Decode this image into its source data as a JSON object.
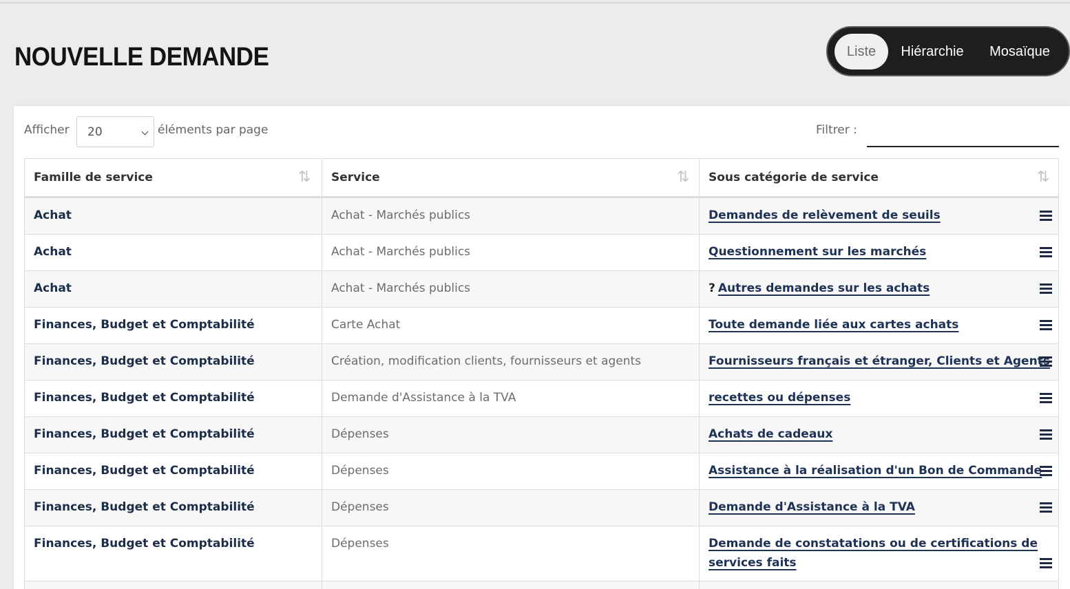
{
  "page": {
    "title": "NOUVELLE DEMANDE"
  },
  "view_switch": {
    "tabs": [
      "Liste",
      "Hiérarchie",
      "Mosaïque"
    ],
    "active": "Liste"
  },
  "controls": {
    "show_label": "Afficher",
    "page_size": "20",
    "per_page_label": "éléments par page",
    "filter_label": "Filtrer :",
    "filter_value": ""
  },
  "table": {
    "headers": [
      "Famille de service",
      "Service",
      "Sous catégorie de service"
    ],
    "sort_icon": "⇅",
    "rows": [
      {
        "famille": "Achat",
        "service": "Achat - Marchés publics",
        "sous": "Demandes de relèvement de seuils"
      },
      {
        "famille": "Achat",
        "service": "Achat - Marchés publics",
        "sous": "Questionnement sur les marchés"
      },
      {
        "famille": "Achat",
        "service": "Achat - Marchés publics",
        "sous": "Autres demandes sur les achats",
        "icon": "question-icon"
      },
      {
        "famille": "Finances, Budget et Comptabilité",
        "service": "Carte Achat",
        "sous": "Toute demande liée aux cartes achats"
      },
      {
        "famille": "Finances, Budget et Comptabilité",
        "service": "Création, modification clients, fournisseurs et agents",
        "sous": "Fournisseurs français et étranger, Clients et Agents"
      },
      {
        "famille": "Finances, Budget et Comptabilité",
        "service": "Demande d'Assistance à la TVA",
        "sous": "recettes ou dépenses"
      },
      {
        "famille": "Finances, Budget et Comptabilité",
        "service": "Dépenses",
        "sous": "Achats de cadeaux"
      },
      {
        "famille": "Finances, Budget et Comptabilité",
        "service": "Dépenses",
        "sous": "Assistance à la réalisation d'un Bon de Commande"
      },
      {
        "famille": "Finances, Budget et Comptabilité",
        "service": "Dépenses",
        "sous": "Demande d'Assistance à la TVA"
      },
      {
        "famille": "Finances, Budget et Comptabilité",
        "service": "Dépenses",
        "sous": "Demande de constatations ou de certifications de services faits"
      }
    ]
  },
  "colors": {
    "accent": "#1e3255",
    "header_bg": "#ececec",
    "switch_bg": "#1e1e1e"
  }
}
